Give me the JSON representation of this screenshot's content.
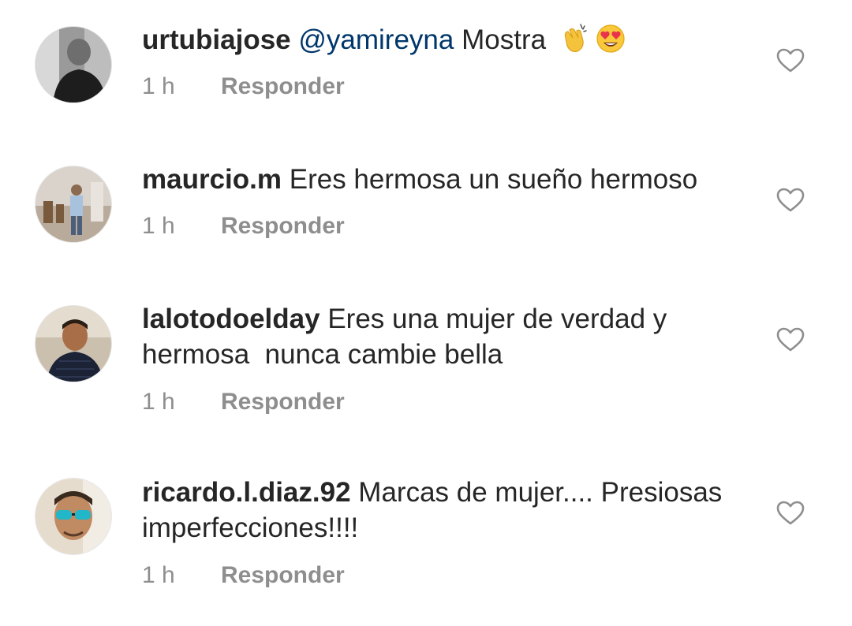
{
  "reply_label": "Responder",
  "like_icon": "heart-outline-icon",
  "colors": {
    "text": "#262626",
    "muted": "#8e8e8e",
    "mention": "#00376b"
  },
  "comments": [
    {
      "username": "urtubiajose",
      "mention": "@yamireyna",
      "text": "Mostra",
      "emojis": [
        "clapping-hands-emoji",
        "heart-eyes-emoji"
      ],
      "time": "1 h"
    },
    {
      "username": "maurcio.m",
      "text": "Eres hermosa un sueño hermoso",
      "time": "1 h"
    },
    {
      "username": "lalotodoelday",
      "text": "Eres una mujer de verdad y hermosa  nunca cambie bella",
      "time": "1 h"
    },
    {
      "username": "ricardo.l.diaz.92",
      "text": "Marcas de mujer.... Presiosas imperfecciones!!!!",
      "time": "1 h"
    }
  ]
}
